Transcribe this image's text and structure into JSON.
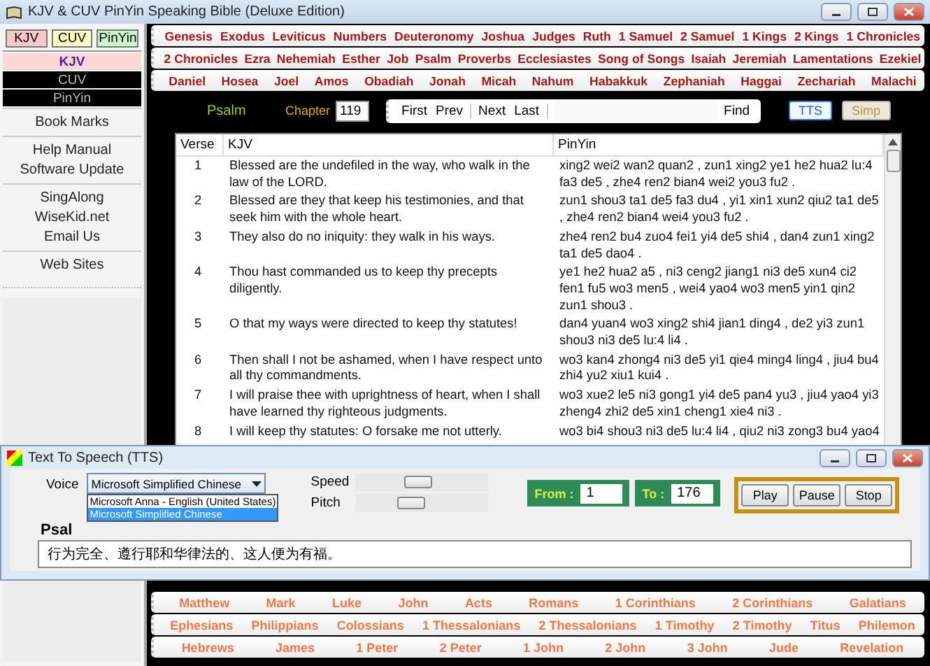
{
  "window": {
    "title": "KJV & CUV PinYin Speaking Bible (Deluxe Edition)"
  },
  "version_toggles": [
    {
      "label": "KJV",
      "color": "#f8c8c8"
    },
    {
      "label": "CUV",
      "color": "#ffffc0"
    },
    {
      "label": "PinYin",
      "color": "#c8f8c8"
    }
  ],
  "versions": [
    {
      "label": "KJV",
      "selected": true
    },
    {
      "label": "CUV",
      "selected": false
    },
    {
      "label": "PinYin",
      "selected": false
    }
  ],
  "menu_groups": [
    [
      "Book Marks"
    ],
    [
      "Help Manual",
      "Software Update"
    ],
    [
      "SingAlong",
      "WiseKid.net",
      "Email Us"
    ],
    [
      "Web Sites"
    ]
  ],
  "ot_books": [
    [
      "Genesis",
      "Exodus",
      "Leviticus",
      "Numbers",
      "Deuteronomy",
      "Joshua",
      "Judges",
      "Ruth",
      "1 Samuel",
      "2 Samuel",
      "1 Kings",
      "2 Kings",
      "1 Chronicles"
    ],
    [
      "2 Chronicles",
      "Ezra",
      "Nehemiah",
      "Esther",
      "Job",
      "Psalm",
      "Proverbs",
      "Ecclesiastes",
      "Song of Songs",
      "Isaiah",
      "Jeremiah",
      "Lamentations",
      "Ezekiel"
    ],
    [
      "Daniel",
      "Hosea",
      "Joel",
      "Amos",
      "Obadiah",
      "Jonah",
      "Micah",
      "Nahum",
      "Habakkuk",
      "Zephaniah",
      "Haggai",
      "Zechariah",
      "Malachi"
    ]
  ],
  "nav": {
    "book": "Psalm",
    "chapter_label": "Chapter",
    "chapter": "119",
    "button_groups": [
      [
        "First",
        "Prev"
      ],
      [
        "Next",
        "Last"
      ]
    ],
    "find": "Find",
    "tts": "TTS",
    "simp": "Simp"
  },
  "table": {
    "columns": [
      "Verse",
      "KJV",
      "PinYin"
    ],
    "rows": [
      {
        "verse": "1",
        "kjv": "Blessed are the undefiled in the way, who walk in the law of the LORD.",
        "pinyin": "xing2 wei2 wan2 quan2 , zun1 xing2 ye1 he2 hua2 lu:4 fa3 de5 , zhe4 ren2 bian4 wei2 you3 fu2 ."
      },
      {
        "verse": "2",
        "kjv": "Blessed are they that keep his testimonies, and that seek him with the whole heart.",
        "pinyin": "zun1 shou3 ta1 de5 fa3 du4 , yi1 xin1 xun2 qiu2 ta1 de5 , zhe4 ren2 bian4 wei4 you3 fu2 ."
      },
      {
        "verse": "3",
        "kjv": "They also do no iniquity: they walk in his ways.",
        "pinyin": "zhe4 ren2 bu4 zuo4 fei1 yi4 de5 shi4 , dan4 zun1 xing2 ta1 de5 dao4 ."
      },
      {
        "verse": "4",
        "kjv": "Thou hast commanded us to keep thy precepts diligently.",
        "pinyin": "ye1 he2 hua2 a5 , ni3 ceng2 jiang1 ni3 de5 xun4 ci2 fen1 fu5 wo3 men5 , wei4 yao4 wo3 men5 yin1 qin2 zun1 shou3 ."
      },
      {
        "verse": "5",
        "kjv": "O that my ways were directed to keep thy statutes!",
        "pinyin": "dan4 yuan4 wo3 xing2 shi4 jian1 ding4 , de2 yi3 zun1 shou3 ni3 de5 lu:4 li4 ."
      },
      {
        "verse": "6",
        "kjv": "Then shall I not be ashamed, when I have respect unto all thy commandments.",
        "pinyin": "wo3 kan4 zhong4 ni3 de5 yi1 qie4 ming4 ling4 , jiu4 bu4 zhi4 yu2 xiu1 kui4 ."
      },
      {
        "verse": "7",
        "kjv": "I will praise thee with uprightness of heart, when I shall have learned thy righteous judgments.",
        "pinyin": "wo3 xue2 le5 ni3 gong1 yi4 de5 pan4 yu3 , jiu4 yao4 yi3 zheng4 zhi2 de5 xin1 cheng1 xie4 ni3 ."
      },
      {
        "verse": "8",
        "kjv": "I will keep thy statutes: O forsake me not utterly.",
        "pinyin": "wo3 bi4 shou3 ni3 de5 lu:4 li4 , qiu2 ni3 zong3 bu4 yao4"
      }
    ]
  },
  "tts": {
    "title": "Text To Speech (TTS)",
    "voice_label": "Voice",
    "voice": "Microsoft Simplified Chinese",
    "voice_options": [
      {
        "label": "Microsoft Anna - English (United States)",
        "selected": false
      },
      {
        "label": "Microsoft Simplified Chinese",
        "selected": true
      }
    ],
    "heading": "Psal",
    "sliders": [
      {
        "label": "Speed",
        "level": 0.47
      },
      {
        "label": "Pitch",
        "level": 0.42
      }
    ],
    "from_label": "From :",
    "from": "1",
    "to_label": "To :",
    "to": "176",
    "buttons": [
      "Play",
      "Pause",
      "Stop"
    ],
    "text": "行为完全、遵行耶和华律法的、这人便为有福。"
  },
  "nt_books": [
    [
      "Matthew",
      "Mark",
      "Luke",
      "John",
      "Acts",
      "Romans",
      "1 Corinthians",
      "2 Corinthians",
      "Galatians"
    ],
    [
      "Ephesians",
      "Philippians",
      "Colossians",
      "1 Thessalonians",
      "2 Thessalonians",
      "1 Timothy",
      "2 Timothy",
      "Titus",
      "Philemon"
    ],
    [
      "Hebrews",
      "James",
      "1 Peter",
      "2 Peter",
      "1 John",
      "2 John",
      "3 John",
      "Jude",
      "Revelation"
    ]
  ]
}
